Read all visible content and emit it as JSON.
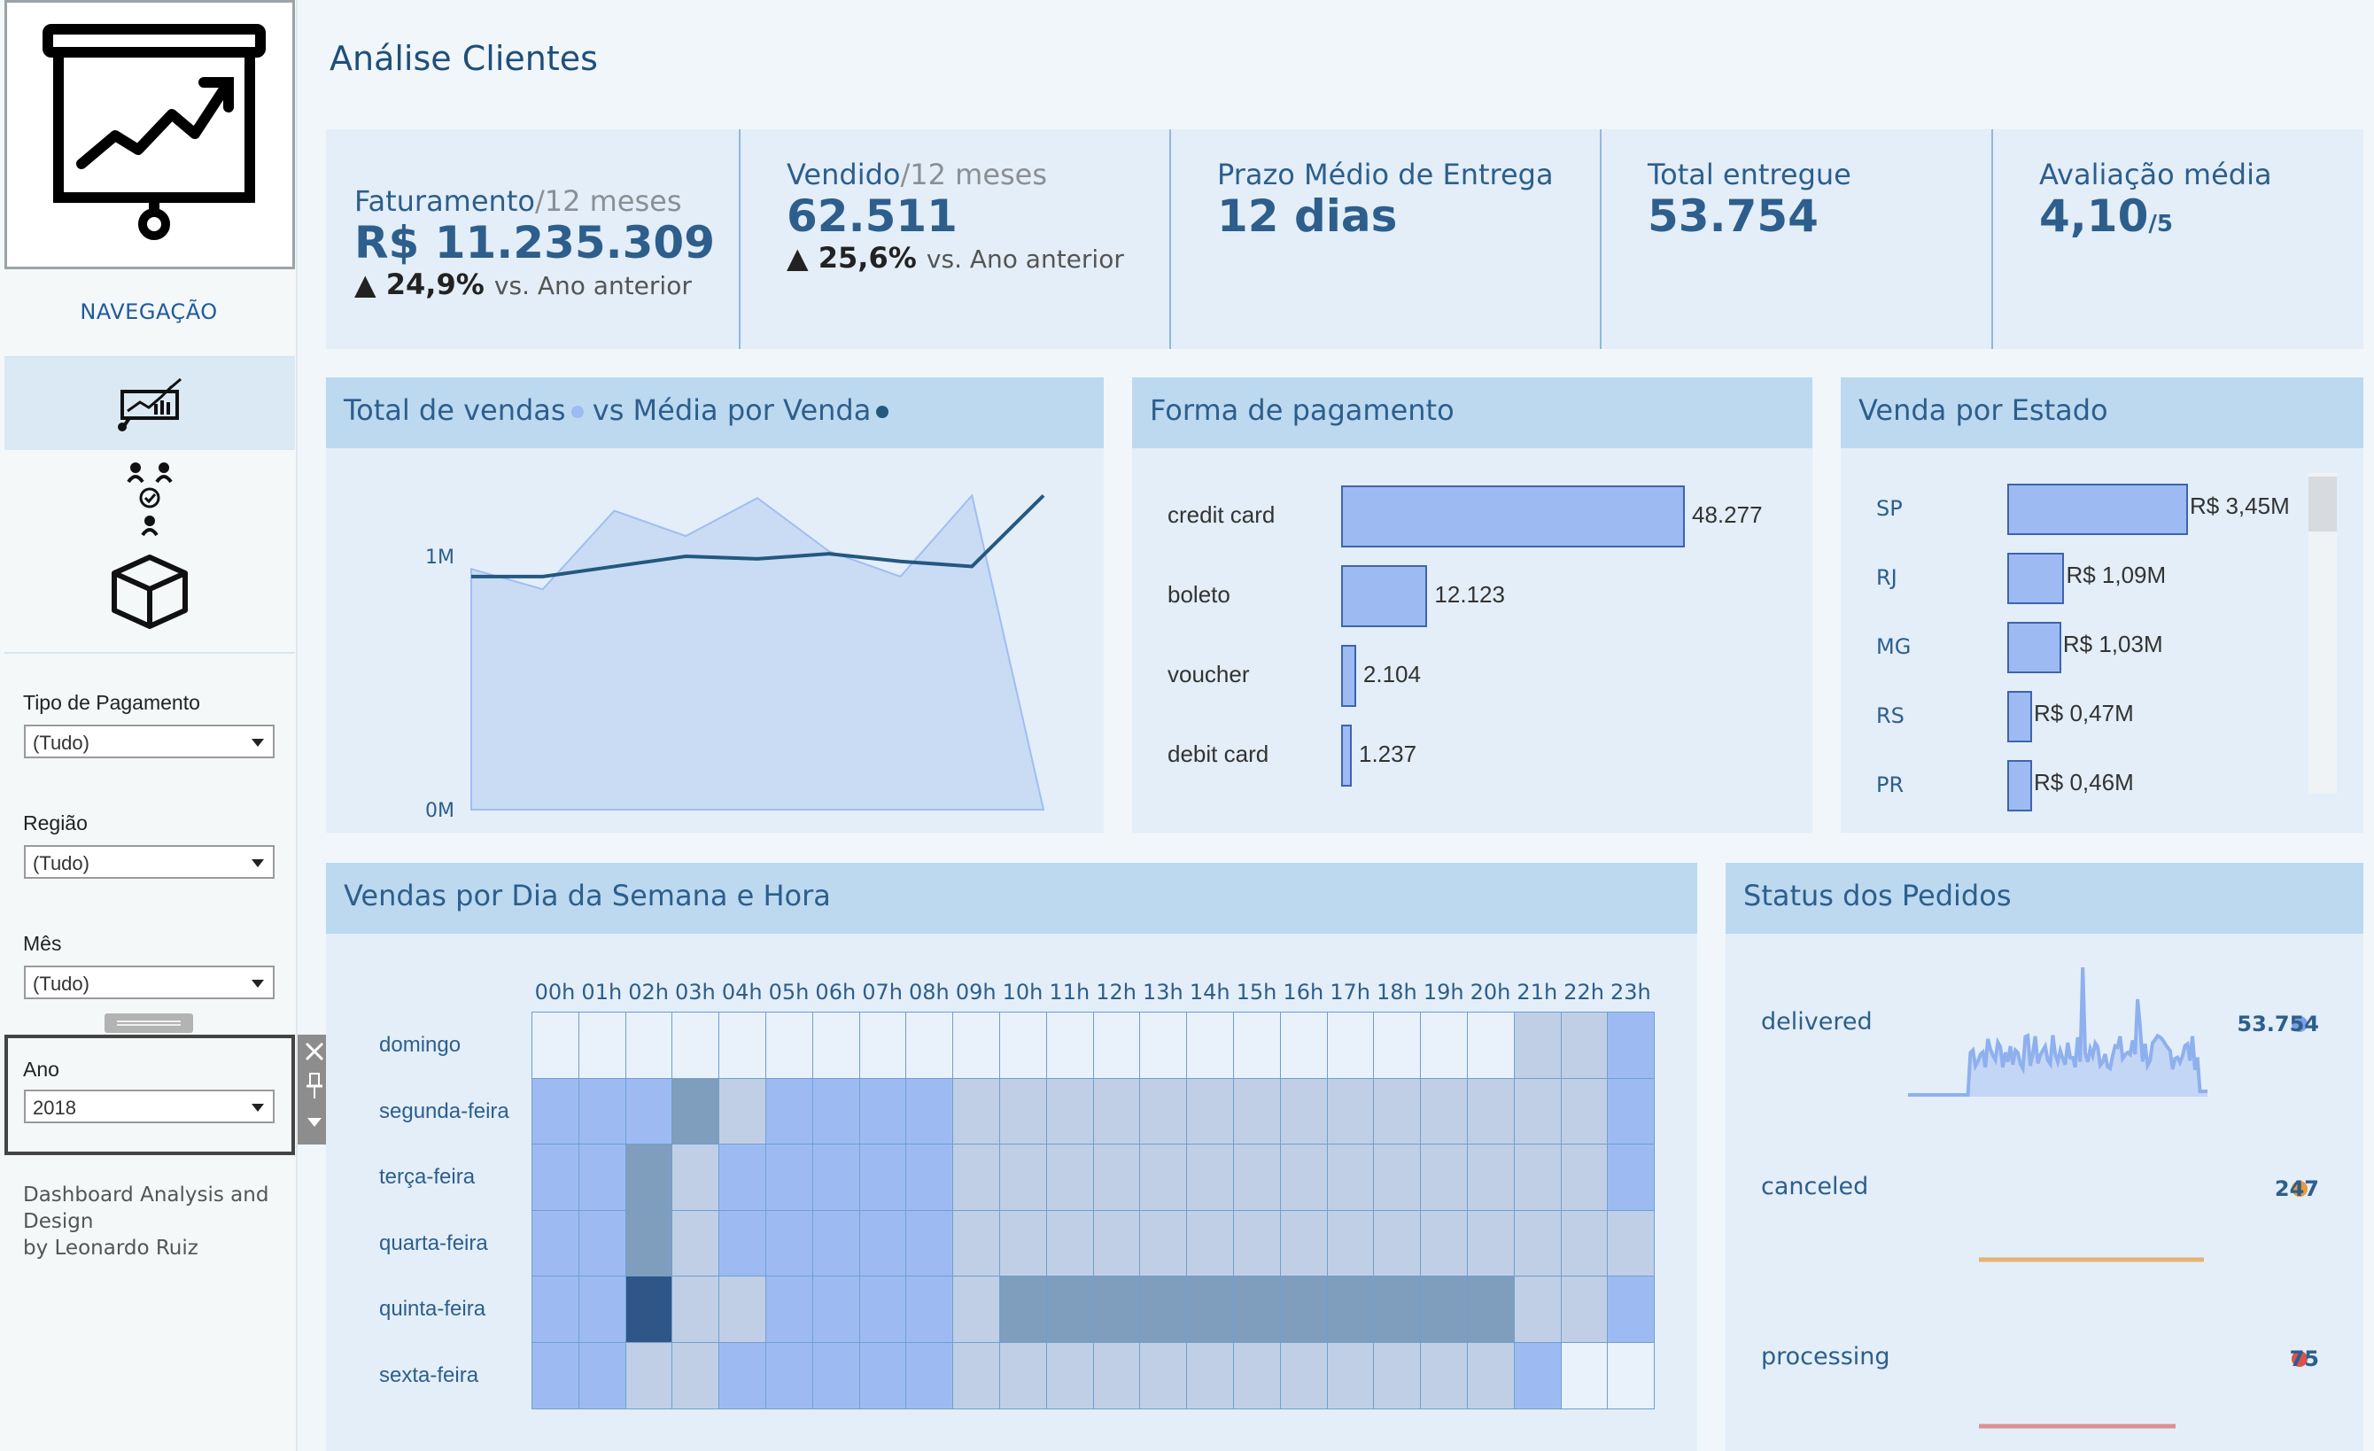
{
  "page": {
    "title": "Análise Clientes"
  },
  "sidebar": {
    "nav_title": "NAVEGAÇÃO",
    "nav_items": [
      {
        "icon": "presentation-chart-icon"
      },
      {
        "icon": "people-network-icon"
      },
      {
        "icon": "package-box-icon"
      }
    ],
    "filters": {
      "pagamento": {
        "label": "Tipo de Pagamento",
        "value": "(Tudo)"
      },
      "regiao": {
        "label": "Região",
        "value": "(Tudo)"
      },
      "mes": {
        "label": "Mês",
        "value": "(Tudo)"
      },
      "ano": {
        "label": "Ano",
        "value": "2018"
      }
    },
    "credits": {
      "line1": "Dashboard Analysis and",
      "line2": "Design",
      "line3": "by Leonardo Ruiz"
    }
  },
  "kpis": {
    "faturamento": {
      "label": "Faturamento",
      "period": "/12 meses",
      "value": "R$ 11.235.309",
      "delta": "▲ 24,9%",
      "delta_suffix": "vs. Ano anterior"
    },
    "vendido": {
      "label": "Vendido",
      "period": "/12 meses",
      "value": "62.511",
      "delta": "▲ 25,6%",
      "delta_suffix": "vs. Ano anterior"
    },
    "prazo": {
      "label": "Prazo Médio de Entrega",
      "value": "12 dias"
    },
    "entregue": {
      "label": "Total entregue",
      "value": "53.754"
    },
    "avaliacao": {
      "label": "Avaliação média",
      "value": "4,10",
      "suffix": "/5"
    }
  },
  "panels": {
    "vendas": {
      "title": "Total de vendas",
      "vs": "vs Média por Venda"
    },
    "pagamento": {
      "title": "Forma de pagamento"
    },
    "estado": {
      "title": "Venda por Estado"
    },
    "heatmap": {
      "title": "Vendas por Dia da Semana e Hora"
    },
    "status": {
      "title": "Status dos Pedidos"
    }
  },
  "colors": {
    "accent": "#2d5e8c",
    "panel_head": "#bcd9f0",
    "panel_body": "#e3eef8",
    "bar": "#9dbbf2",
    "line": "#23587f",
    "orange": "#e89a3c",
    "red": "#d9534f"
  },
  "chart_data": [
    {
      "type": "area",
      "title": "Total de vendas vs Média por Venda",
      "y_ticks": [
        "1M",
        "0M"
      ],
      "series": [
        {
          "name": "Total de vendas",
          "type": "area",
          "values": [
            0.95,
            0.87,
            1.18,
            1.08,
            1.23,
            1.02,
            0.92,
            1.24,
            0.0
          ]
        },
        {
          "name": "Média por Venda",
          "type": "line",
          "values": [
            0.92,
            0.92,
            0.96,
            1.0,
            0.99,
            1.01,
            0.98,
            0.96,
            1.24
          ]
        }
      ]
    },
    {
      "type": "bar",
      "title": "Forma de pagamento",
      "categories": [
        "credit card",
        "boleto",
        "voucher",
        "debit card"
      ],
      "values": [
        48277,
        12123,
        2104,
        1237
      ],
      "labels": [
        "48.277",
        "12.123",
        "2.104",
        "1.237"
      ]
    },
    {
      "type": "bar",
      "title": "Venda por Estado",
      "categories": [
        "SP",
        "RJ",
        "MG",
        "RS",
        "PR"
      ],
      "values": [
        3.45,
        1.09,
        1.03,
        0.47,
        0.46
      ],
      "labels": [
        "R$ 3,45M",
        "R$ 1,09M",
        "R$ 1,03M",
        "R$ 0,47M",
        "R$ 0,46M"
      ]
    },
    {
      "type": "heatmap",
      "title": "Vendas por Dia da Semana e Hora",
      "rows": [
        "domingo",
        "segunda-feira",
        "terça-feira",
        "quarta-feira",
        "quinta-feira",
        "sexta-feira"
      ],
      "columns": [
        "00h",
        "01h",
        "02h",
        "03h",
        "04h",
        "05h",
        "06h",
        "07h",
        "08h",
        "09h",
        "10h",
        "11h",
        "12h",
        "13h",
        "14h",
        "15h",
        "16h",
        "17h",
        "18h",
        "19h",
        "20h",
        "21h",
        "22h",
        "23h"
      ],
      "levels": [
        [
          0,
          0,
          0,
          0,
          0,
          0,
          0,
          0,
          0,
          0,
          0,
          0,
          0,
          0,
          0,
          0,
          0,
          0,
          0,
          0,
          0,
          1,
          1,
          2
        ],
        [
          2,
          2,
          2,
          3,
          1,
          2,
          2,
          2,
          2,
          1,
          1,
          1,
          1,
          1,
          1,
          1,
          1,
          1,
          1,
          1,
          1,
          1,
          1,
          2
        ],
        [
          2,
          2,
          3,
          1,
          2,
          2,
          2,
          2,
          2,
          1,
          1,
          1,
          1,
          1,
          1,
          1,
          1,
          1,
          1,
          1,
          1,
          1,
          1,
          2
        ],
        [
          2,
          2,
          3,
          1,
          2,
          2,
          2,
          2,
          2,
          1,
          1,
          1,
          1,
          1,
          1,
          1,
          1,
          1,
          1,
          1,
          1,
          1,
          1,
          1
        ],
        [
          2,
          2,
          4,
          1,
          1,
          2,
          2,
          2,
          2,
          1,
          3,
          3,
          3,
          3,
          3,
          3,
          3,
          3,
          3,
          3,
          3,
          1,
          1,
          2
        ],
        [
          2,
          2,
          1,
          1,
          2,
          2,
          2,
          2,
          2,
          1,
          1,
          1,
          1,
          1,
          1,
          1,
          1,
          1,
          1,
          1,
          1,
          2,
          0,
          0
        ]
      ]
    },
    {
      "type": "line",
      "title": "Status dos Pedidos",
      "categories": [
        "delivered",
        "canceled",
        "processing"
      ],
      "values": [
        53754,
        247,
        75
      ],
      "labels": [
        "53.754",
        "247",
        "75"
      ]
    }
  ]
}
